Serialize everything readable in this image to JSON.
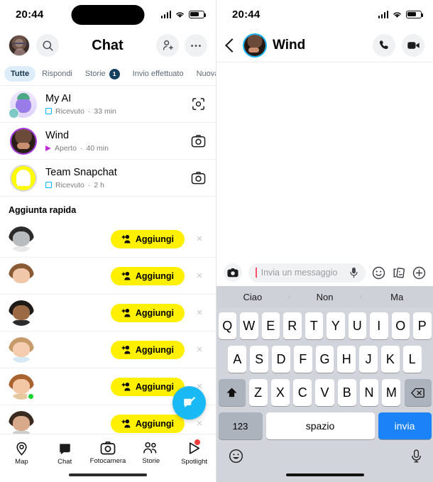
{
  "status": {
    "time": "20:44",
    "signal_icon": "cellular-signal-icon",
    "wifi_icon": "wifi-icon",
    "battery_icon": "battery-icon"
  },
  "left": {
    "header": {
      "title": "Chat",
      "avatar_icon": "profile-avatar",
      "search_icon": "search-icon",
      "add_friend_icon": "add-friend-icon",
      "more_icon": "more-options-icon"
    },
    "tabs": [
      {
        "label": "Tutte",
        "active": true,
        "badge": ""
      },
      {
        "label": "Rispondi",
        "active": false,
        "badge": ""
      },
      {
        "label": "Storie",
        "active": false,
        "badge": "1"
      },
      {
        "label": "Invio effettuato",
        "active": false,
        "badge": ""
      },
      {
        "label": "Nuova",
        "active": false,
        "badge": ""
      }
    ],
    "new_tab_plus": "+",
    "chats": [
      {
        "name": "My AI",
        "status": "Ricevuto",
        "time": "33 min",
        "sep": "·",
        "status_icon": "received-square-icon",
        "action_icon": "scan-icon"
      },
      {
        "name": "Wind",
        "status": "Aperto",
        "time": "40 min",
        "sep": "·",
        "status_icon": "opened-arrow-icon",
        "action_icon": "camera-icon"
      },
      {
        "name": "Team Snapchat",
        "status": "Ricevuto",
        "time": "2 h",
        "sep": "·",
        "status_icon": "received-square-icon",
        "action_icon": "camera-icon"
      }
    ],
    "quick_add": {
      "title": "Aggiunta rapida",
      "add_label": "Aggiungi",
      "dismiss_icon": "close-icon",
      "add_icon": "add-person-icon",
      "rows": [
        {
          "hair": "#2b2b2b",
          "skin": "#b9bcbe",
          "body": "#e9e9ea",
          "online": false
        },
        {
          "hair": "#8a5a34",
          "skin": "#f0c7a8",
          "body": "#ffffff",
          "online": false
        },
        {
          "hair": "#1d1a17",
          "skin": "#9b6a45",
          "body": "#2b2b2b",
          "online": false
        },
        {
          "hair": "#c79a6a",
          "skin": "#f4cdb0",
          "body": "#d7e8f5",
          "online": false
        },
        {
          "hair": "#a8632f",
          "skin": "#f3c6a4",
          "body": "#e7c9a0",
          "online": true
        },
        {
          "hair": "#3a2a1e",
          "skin": "#d8a98a",
          "body": "#cccccc",
          "online": false
        }
      ]
    },
    "fab_icon": "new-chat-icon",
    "nav": [
      {
        "label": "Map",
        "icon": "map-pin-icon",
        "badge": false
      },
      {
        "label": "Chat",
        "icon": "chat-bubble-icon",
        "badge": false
      },
      {
        "label": "Fotocamera",
        "icon": "camera-icon",
        "badge": false
      },
      {
        "label": "Storie",
        "icon": "stories-people-icon",
        "badge": false
      },
      {
        "label": "Spotlight",
        "icon": "spotlight-play-icon",
        "badge": true
      }
    ]
  },
  "right": {
    "header": {
      "back_icon": "back-chevron-icon",
      "name": "Wind",
      "avatar_icon": "contact-avatar",
      "call_icon": "phone-call-icon",
      "video_icon": "video-call-icon"
    },
    "composer": {
      "camera_icon": "camera-icon",
      "placeholder": "Invia un messaggio",
      "mic_icon": "microphone-icon",
      "emoji_icon": "smiley-icon",
      "sticker_icon": "sticker-icon",
      "plus_icon": "plus-circle-icon"
    },
    "suggestions": [
      "Ciao",
      "Non",
      "Ma"
    ],
    "keyboard": {
      "row1": [
        "Q",
        "W",
        "E",
        "R",
        "T",
        "Y",
        "U",
        "I",
        "O",
        "P"
      ],
      "row2": [
        "A",
        "S",
        "D",
        "F",
        "G",
        "H",
        "J",
        "K",
        "L"
      ],
      "row3": [
        "Z",
        "X",
        "C",
        "V",
        "B",
        "N",
        "M"
      ],
      "shift_icon": "shift-icon",
      "backspace_icon": "backspace-icon",
      "numbers_label": "123",
      "space_label": "spazio",
      "send_label": "invia",
      "emoji_icon": "keyboard-emoji-icon",
      "dictation_icon": "dictation-mic-icon"
    }
  },
  "colors": {
    "snap_yellow": "#fff000",
    "accent_blue": "#19b9f5",
    "send_blue": "#1b82f7",
    "tab_active_bg": "#ddeefa",
    "online_green": "#14d32c"
  }
}
